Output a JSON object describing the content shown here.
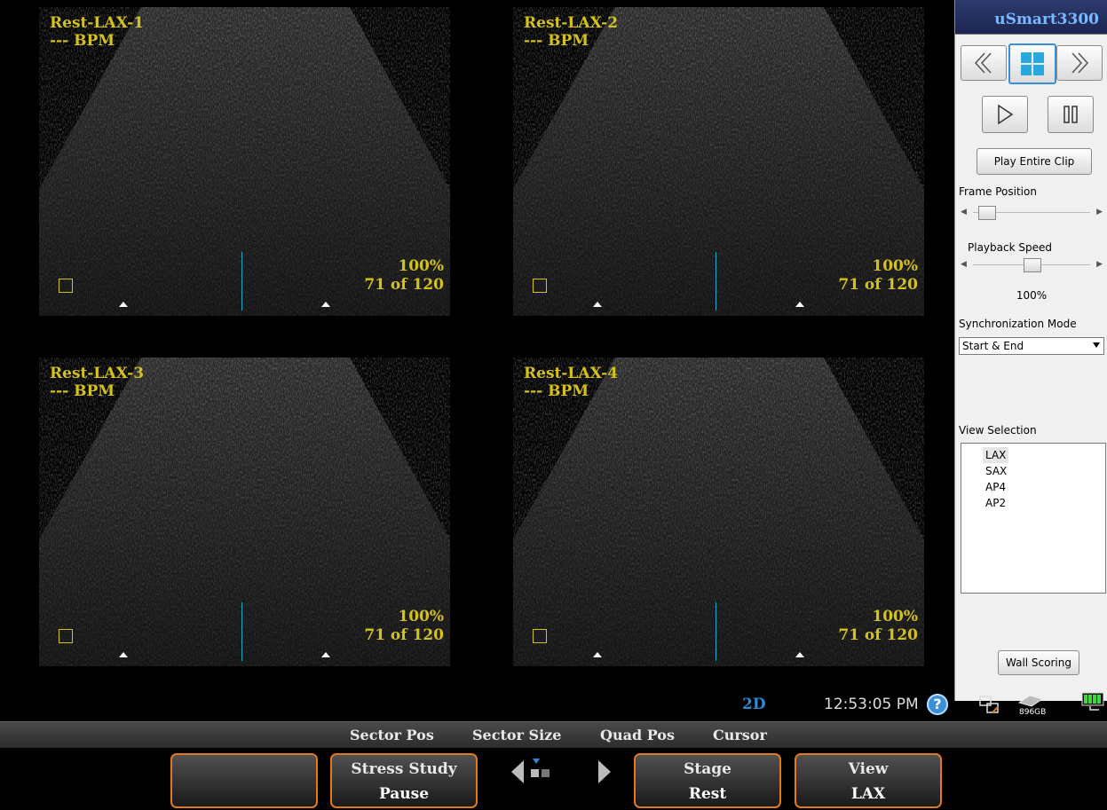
{
  "app": {
    "brand": "uSmart3300"
  },
  "quadrants": [
    {
      "title": "Rest-LAX-1",
      "bpm": "--- BPM",
      "zoom": "100%",
      "frame": "71 of 120"
    },
    {
      "title": "Rest-LAX-2",
      "bpm": "--- BPM",
      "zoom": "100%",
      "frame": "71 of 120"
    },
    {
      "title": "Rest-LAX-3",
      "bpm": "--- BPM",
      "zoom": "100%",
      "frame": "71 of 120"
    },
    {
      "title": "Rest-LAX-4",
      "bpm": "--- BPM",
      "zoom": "100%",
      "frame": "71 of 120"
    }
  ],
  "panel": {
    "play_clip_label": "Play Entire Clip",
    "frame_position_label": "Frame Position",
    "frame_position_value": 0.04,
    "playback_speed_label": "Playback Speed",
    "playback_speed_value": 0.5,
    "speed_readout": "100%",
    "sync_label": "Synchronization Mode",
    "sync_value": "Start & End",
    "view_selection_label": "View Selection",
    "views": [
      "LAX",
      "SAX",
      "AP4",
      "AP2"
    ],
    "selected_view": "LAX",
    "wall_scoring_label": "Wall Scoring"
  },
  "status": {
    "mode": "2D",
    "time": "12:53:05 PM",
    "help": "?",
    "disk": "896GB"
  },
  "softkeys": [
    "Sector Pos",
    "Sector Size",
    "Quad Pos",
    "Cursor"
  ],
  "keys": {
    "stress_study": {
      "top": "Stress Study",
      "bottom": "Pause"
    },
    "stage": {
      "top": "Stage",
      "bottom": "Rest"
    },
    "view": {
      "top": "View",
      "bottom": "LAX"
    }
  },
  "colors": {
    "overlay_text": "#d4c21a",
    "accent_orange": "#e07a1c",
    "cursor_line": "#1aa8c8"
  }
}
